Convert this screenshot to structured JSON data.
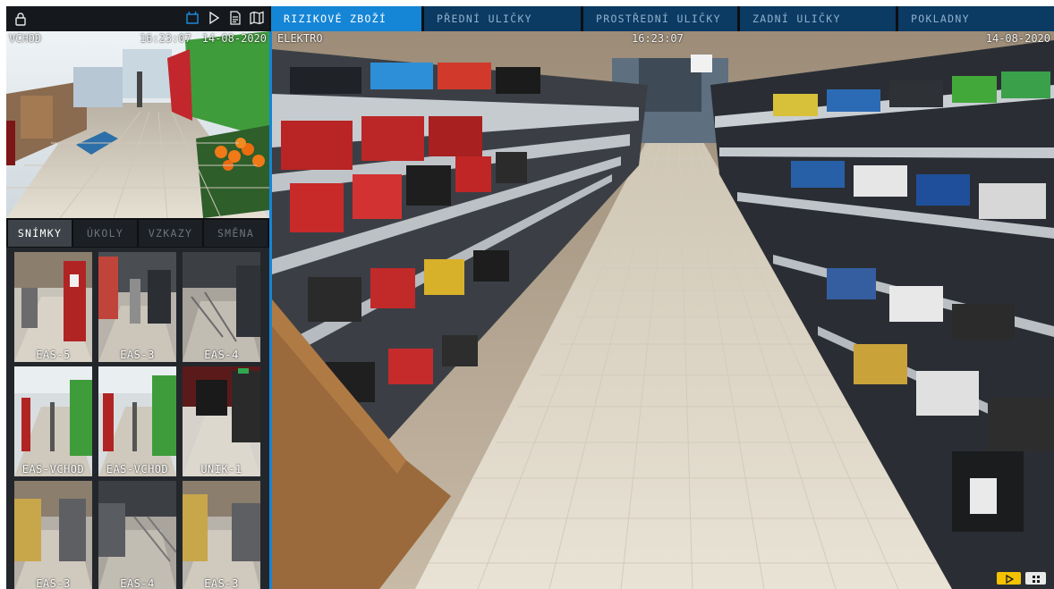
{
  "topbar": {
    "icons": [
      "lock-icon",
      "camera-icon",
      "play-icon",
      "document-icon",
      "map-icon"
    ],
    "colors": {
      "accent": "#1585d6",
      "tab_inactive": "#0b3a63"
    }
  },
  "tabs": [
    {
      "label": "RIZIKOVÉ ZBOŽÍ",
      "active": true
    },
    {
      "label": "PŘEDNÍ ULIČKY",
      "active": false
    },
    {
      "label": "PROSTŘEDNÍ ULIČKY",
      "active": false
    },
    {
      "label": "ZADNÍ ULIČKY",
      "active": false
    },
    {
      "label": "POKLADNY",
      "active": false
    }
  ],
  "entrance_cam": {
    "name": "VCHOD",
    "time": "16:23:07",
    "date": "14-08-2020"
  },
  "subtabs": [
    {
      "label": "SNÍMKY",
      "active": true
    },
    {
      "label": "ÚKOLY",
      "active": false
    },
    {
      "label": "VZKAZY",
      "active": false
    },
    {
      "label": "SMĚNA",
      "active": false
    }
  ],
  "snapshots": [
    {
      "label": "EAS-5"
    },
    {
      "label": "EAS-3"
    },
    {
      "label": "EAS-4"
    },
    {
      "label": "EAS-VCHOD"
    },
    {
      "label": "EAS-VCHOD"
    },
    {
      "label": "UNIK-1"
    },
    {
      "label": "EAS-3"
    },
    {
      "label": "EAS-4"
    },
    {
      "label": "EAS-3"
    }
  ],
  "main_cam": {
    "name": "ELEKTRO",
    "time": "16:23:07",
    "date": "14-08-2020"
  },
  "controls": {
    "play_icon": "play-icon",
    "grid_icon": "grid-icon",
    "play_color": "#f5c200"
  }
}
